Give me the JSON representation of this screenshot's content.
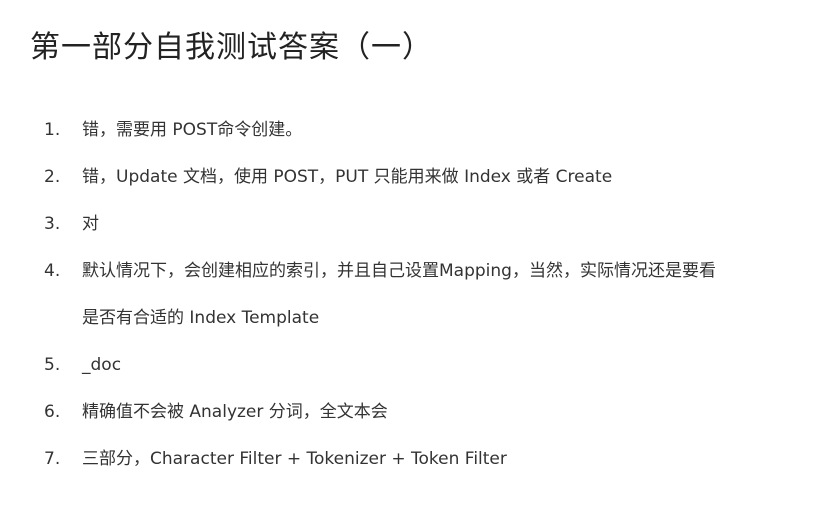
{
  "title": "第一部分自我测试答案（一）",
  "answers": [
    {
      "number": "1.",
      "lines": [
        "错，需要用 POST命令创建。"
      ]
    },
    {
      "number": "2.",
      "lines": [
        "错，Update 文档，使用 POST，PUT 只能用来做 Index 或者 Create"
      ]
    },
    {
      "number": "3.",
      "lines": [
        "对"
      ]
    },
    {
      "number": "4.",
      "lines": [
        "默认情况下，会创建相应的索引，并且自己设置Mapping，当然，实际情况还是要看",
        "是否有合适的 Index Template"
      ]
    },
    {
      "number": "5.",
      "lines": [
        "_doc"
      ]
    },
    {
      "number": "6.",
      "lines": [
        "精确值不会被 Analyzer 分词，全文本会"
      ]
    },
    {
      "number": "7.",
      "lines": [
        "三部分，Character Filter + Tokenizer + Token Filter"
      ]
    }
  ]
}
